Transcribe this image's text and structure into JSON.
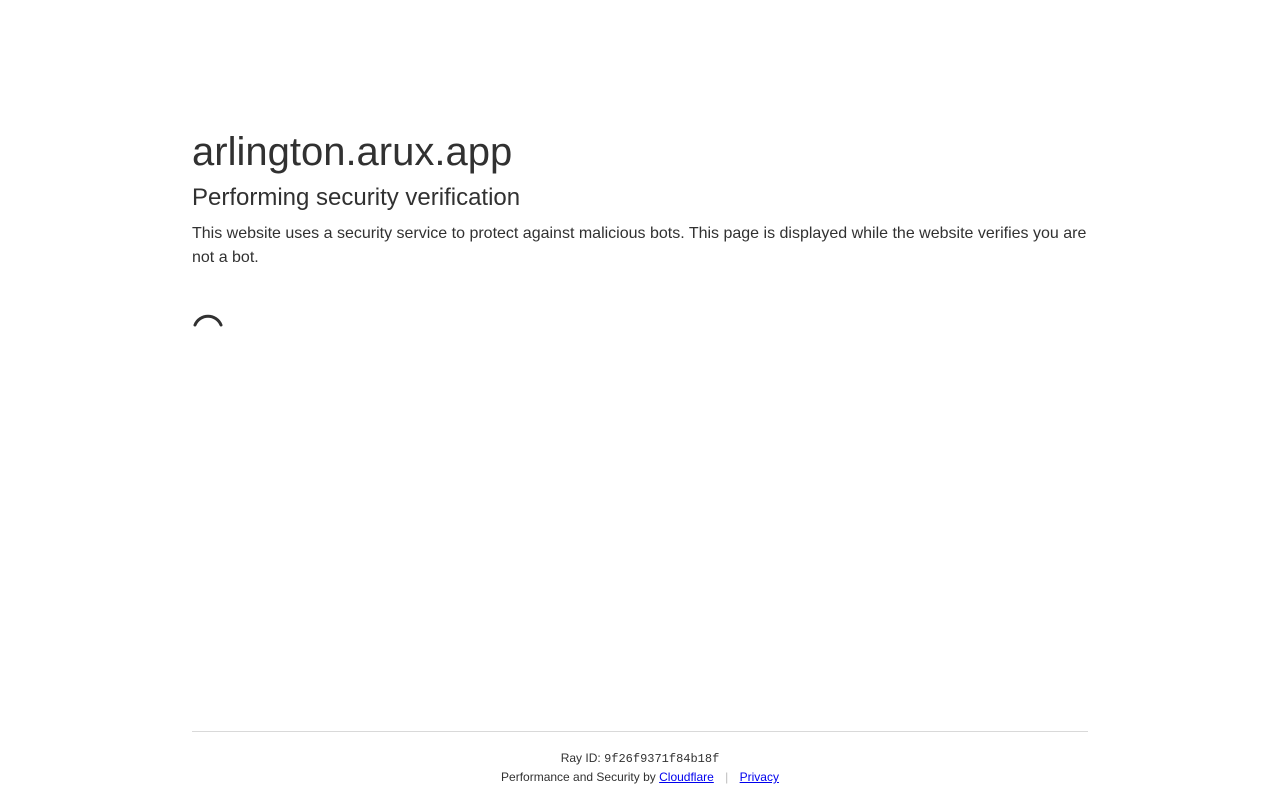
{
  "site": {
    "domain": "arlington.arux.app"
  },
  "verification": {
    "heading": "Performing security verification",
    "description": "This website uses a security service to protect against malicious bots. This page is displayed while the website verifies you are not a bot.",
    "spinner_icon": "loading-spinner-icon"
  },
  "footer": {
    "ray_label": "Ray ID:",
    "ray_id": "9f26f9371f84b18f",
    "performance_text": "Performance and Security by",
    "cloudflare_link": "Cloudflare",
    "separator": "|",
    "privacy_link": "Privacy"
  },
  "colors": {
    "text": "#313131",
    "link": "#0000ee",
    "divider": "#d9d9d9",
    "background": "#ffffff"
  }
}
